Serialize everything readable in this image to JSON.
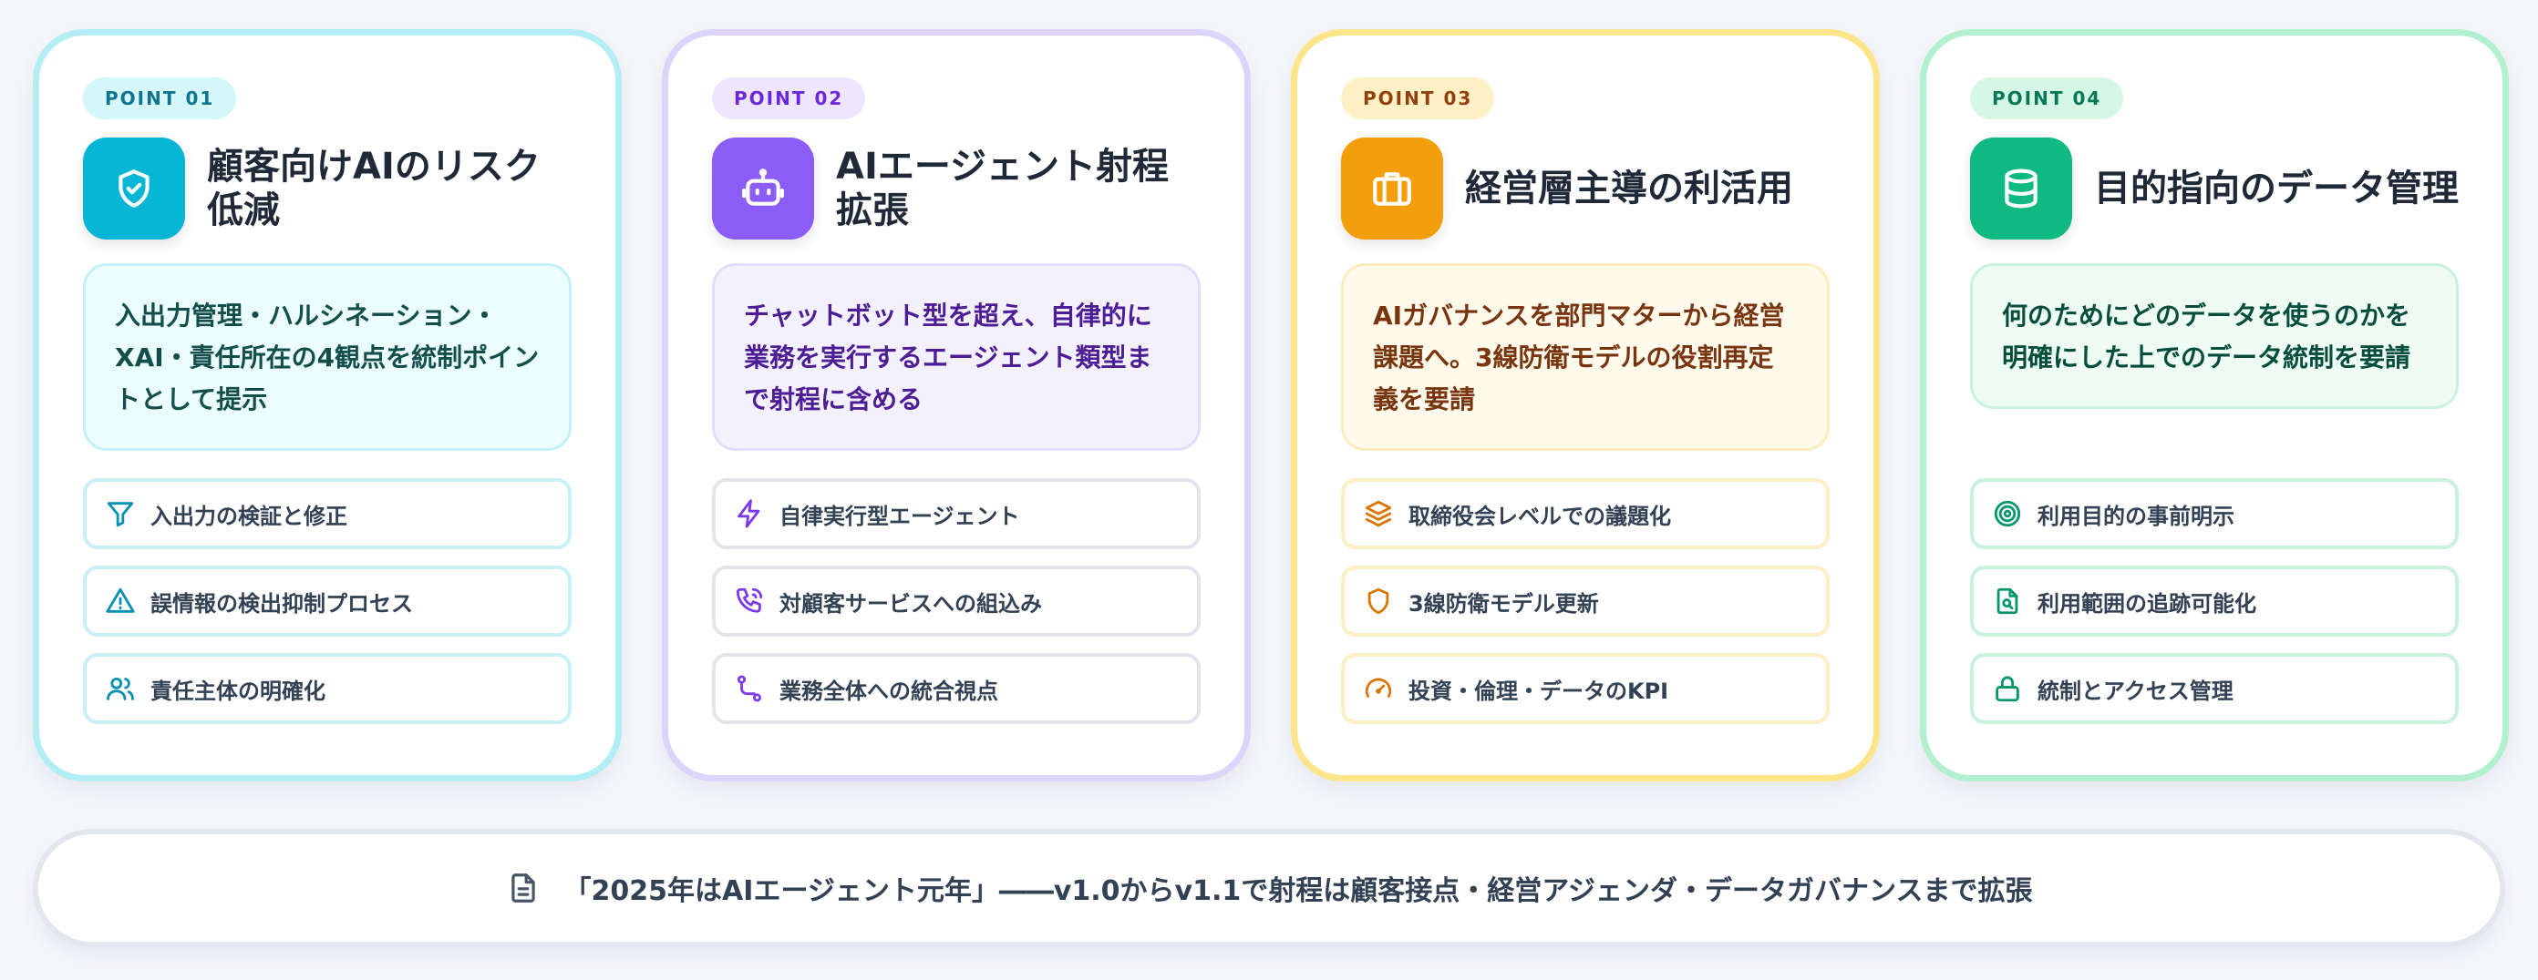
{
  "cards": [
    {
      "point": "POINT 01",
      "icon": "shield-check-icon",
      "title": "顧客向けAIのリスク低減",
      "description": "入出力管理・ハルシネーション・XAI・責任所在の4観点を統制ポイントとして提示",
      "items": [
        {
          "icon": "filter-icon",
          "label": "入出力の検証と修正"
        },
        {
          "icon": "alert-triangle-icon",
          "label": "誤情報の検出抑制プロセス"
        },
        {
          "icon": "users-icon",
          "label": "責任主体の明確化"
        }
      ]
    },
    {
      "point": "POINT 02",
      "icon": "bot-icon",
      "title": "AIエージェント射程拡張",
      "description": "チャットボット型を超え、自律的に業務を実行するエージェント類型まで射程に含める",
      "items": [
        {
          "icon": "zap-icon",
          "label": "自律実行型エージェント"
        },
        {
          "icon": "phone-call-icon",
          "label": "対顧客サービスへの組込み"
        },
        {
          "icon": "route-icon",
          "label": "業務全体への統合視点"
        }
      ]
    },
    {
      "point": "POINT 03",
      "icon": "briefcase-icon",
      "title": "経営層主導の利活用",
      "description": "AIガバナンスを部門マターから経営課題へ。3線防衛モデルの役割再定義を要請",
      "items": [
        {
          "icon": "layers-icon",
          "label": "取締役会レベルでの議題化"
        },
        {
          "icon": "shield-icon",
          "label": "3線防衛モデル更新"
        },
        {
          "icon": "gauge-icon",
          "label": "投資・倫理・データのKPI"
        }
      ]
    },
    {
      "point": "POINT 04",
      "icon": "database-icon",
      "title": "目的指向のデータ管理",
      "description": "何のためにどのデータを使うのかを明確にした上でのデータ統制を要請",
      "items": [
        {
          "icon": "target-icon",
          "label": "利用目的の事前明示"
        },
        {
          "icon": "file-search-icon",
          "label": "利用範囲の追跡可能化"
        },
        {
          "icon": "lock-icon",
          "label": "統制とアクセス管理"
        }
      ]
    }
  ],
  "footer": {
    "icon": "document-icon",
    "text": "「2025年はAIエージェント元年」――v1.0からv1.1で射程は顧客接点・経営アジェンダ・データガバナンスまで拡張"
  },
  "colors": {
    "point01": "#06b6d4",
    "point02": "#8b5cf6",
    "point03": "#f59e0b",
    "point04": "#10b981"
  }
}
